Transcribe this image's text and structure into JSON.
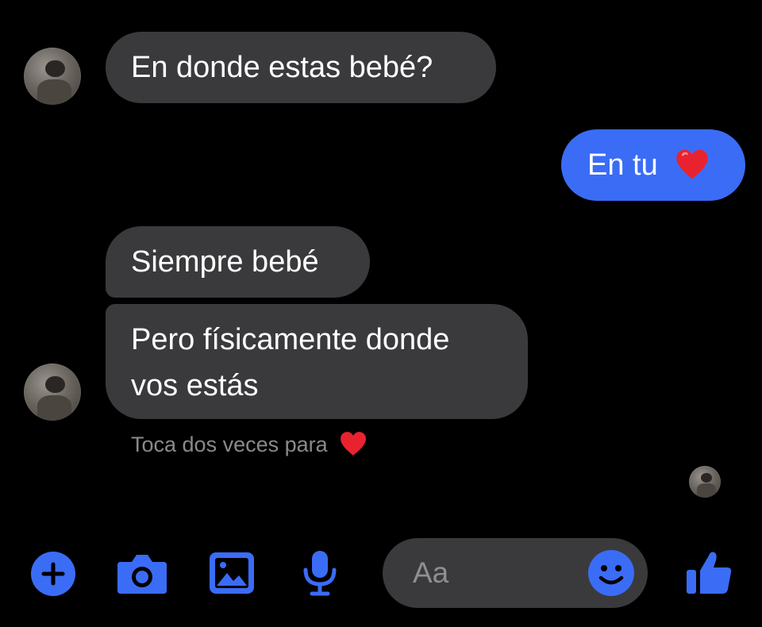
{
  "conversation": {
    "messages": [
      {
        "direction": "in",
        "text": "En donde estas bebé?"
      },
      {
        "direction": "out",
        "text": "En tu",
        "emoji": "red-heart"
      },
      {
        "direction": "in",
        "text": "Siempre bebé"
      },
      {
        "direction": "in",
        "line1": "Pero físicamente donde",
        "line2": "vos estás"
      }
    ],
    "hint": "Toca dos veces para",
    "hint_emoji": "red-heart"
  },
  "composer": {
    "placeholder": "Aa"
  },
  "toolbar": {
    "icons": [
      "plus-icon",
      "camera-icon",
      "gallery-icon",
      "microphone-icon",
      "emoji-icon",
      "thumbs-up-icon"
    ]
  },
  "colors": {
    "background": "#000000",
    "incoming_bubble": "#3a3a3c",
    "outgoing_bubble": "#3b6cf6",
    "accent": "#3b6cf6",
    "heart": "#e8232f",
    "hint_text": "#8a8a8e"
  }
}
